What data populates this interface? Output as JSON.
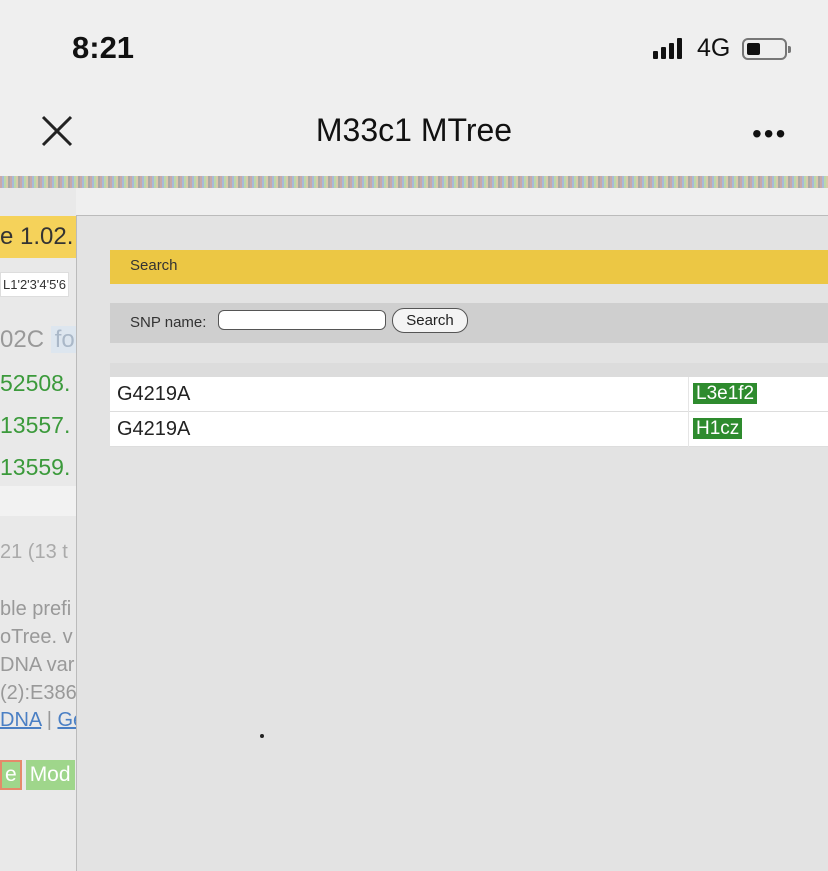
{
  "status_bar": {
    "time": "8:21",
    "network": "4G",
    "battery_level": 0.3
  },
  "nav": {
    "title": "M33c1 MTree",
    "more_label": "•••"
  },
  "background_page": {
    "version": "e 1.02.",
    "tabs": "L1'2'3'4'5'6",
    "code": "02C",
    "code_hl": "fo",
    "green_lines": [
      "52508.",
      "13557.",
      "13559."
    ],
    "count": "21 (13 t",
    "paragraph": [
      "ble prefi",
      "oTree. v",
      "DNA var",
      "(2):E386"
    ],
    "links": [
      "DNA",
      "Ge"
    ],
    "links_sep": "|",
    "buttons": [
      "e",
      "Mod"
    ]
  },
  "dialog": {
    "header": "Search",
    "snp_label": "SNP name:",
    "snp_value": "",
    "search_button": "Search",
    "results": [
      {
        "snp": "G4219A",
        "haplogroup": "L3e1f2"
      },
      {
        "snp": "G4219A",
        "haplogroup": "H1cz"
      }
    ]
  }
}
